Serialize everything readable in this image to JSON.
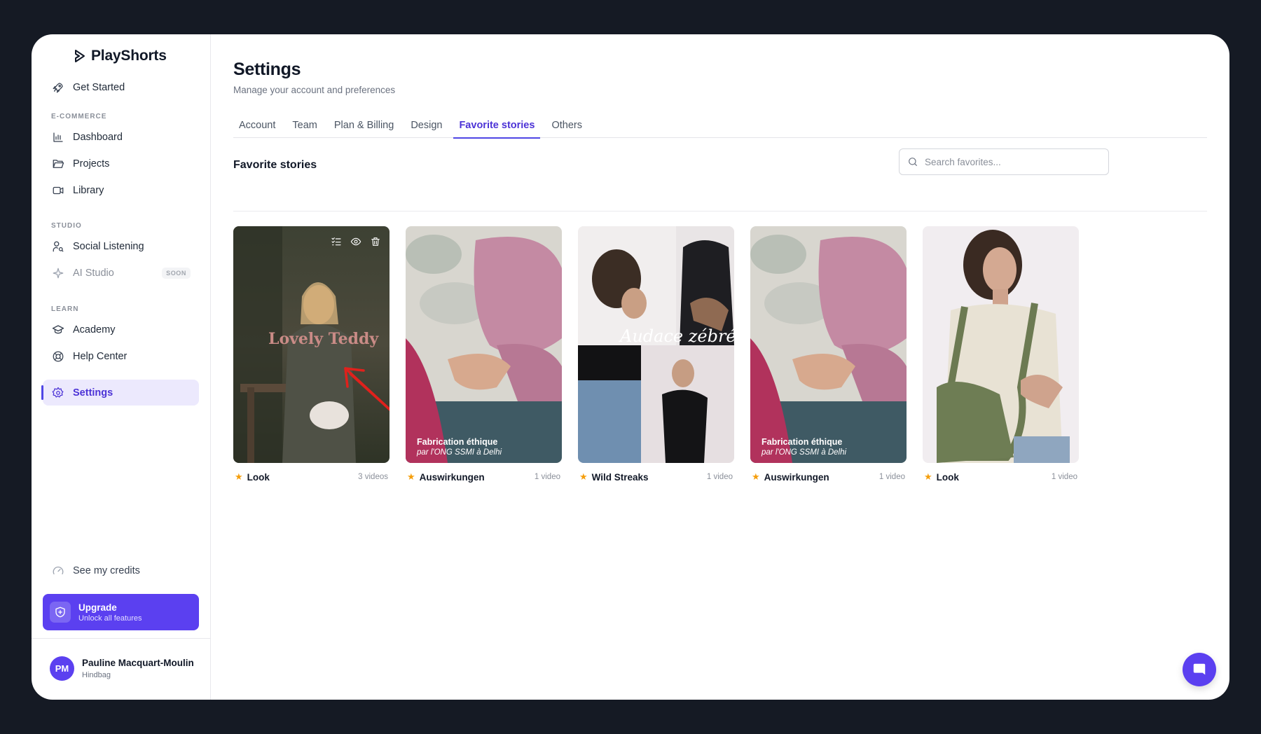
{
  "app": {
    "name": "PlayShorts"
  },
  "sidebar": {
    "get_started": "Get Started",
    "sections": {
      "ecommerce": "E-COMMERCE",
      "studio": "STUDIO",
      "learn": "LEARN"
    },
    "items": {
      "dashboard": "Dashboard",
      "projects": "Projects",
      "library": "Library",
      "social_listening": "Social Listening",
      "ai_studio": "AI Studio",
      "ai_studio_badge": "SOON",
      "academy": "Academy",
      "help_center": "Help Center",
      "settings": "Settings"
    },
    "credits": "See my credits",
    "upgrade": {
      "title": "Upgrade",
      "subtitle": "Unlock all features"
    },
    "user": {
      "initials": "PM",
      "name": "Pauline Macquart-Moulin",
      "org": "Hindbag"
    }
  },
  "header": {
    "title": "Settings",
    "subtitle": "Manage your account and preferences"
  },
  "tabs": [
    "Account",
    "Team",
    "Plan & Billing",
    "Design",
    "Favorite stories",
    "Others"
  ],
  "favorites": {
    "title": "Favorite stories",
    "search_placeholder": "Search favorites...",
    "stories": [
      {
        "label": "Look",
        "count": "3 videos",
        "overlay": "Lovely Teddy"
      },
      {
        "label": "Auswirkungen",
        "count": "1 video",
        "caption1": "Fabrication éthique",
        "caption2": "par l'ONG SSMI à Delhi"
      },
      {
        "label": "Wild Streaks",
        "count": "1 video",
        "overlay": "Audace zébrée"
      },
      {
        "label": "Auswirkungen",
        "count": "1 video",
        "caption1": "Fabrication éthique",
        "caption2": "par l'ONG SSMI à Delhi"
      },
      {
        "label": "Look",
        "count": "1 video"
      }
    ]
  },
  "colors": {
    "accent": "#5b40f0",
    "star": "#f59e0b",
    "active_bg": "#ece9fd"
  }
}
